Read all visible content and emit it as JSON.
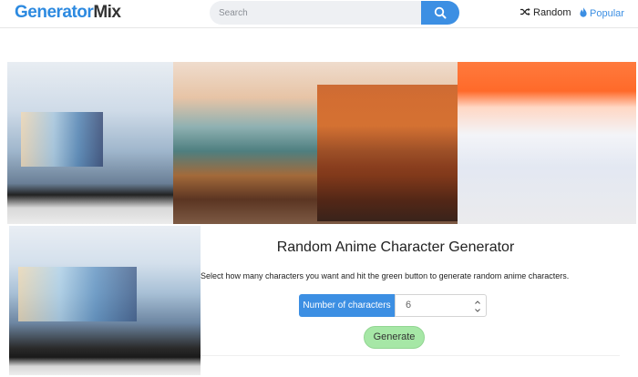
{
  "header": {
    "logo_part1": "Generator",
    "logo_part2": "Mix",
    "search_placeholder": "Search",
    "search_icon": "search-icon",
    "random_label": "Random",
    "random_icon": "shuffle-icon",
    "popular_label": "Popular",
    "popular_icon": "flame-icon"
  },
  "main": {
    "title": "Random Anime Character Generator",
    "description": "Select how many characters you want and hit the green button to generate random anime characters.",
    "count_label": "Number of characters",
    "count_value": "6",
    "generate_label": "Generate"
  },
  "colors": {
    "brand_blue": "#3c8fe3",
    "generate_green": "#a6e7a6",
    "search_bg": "#eef0f3"
  }
}
